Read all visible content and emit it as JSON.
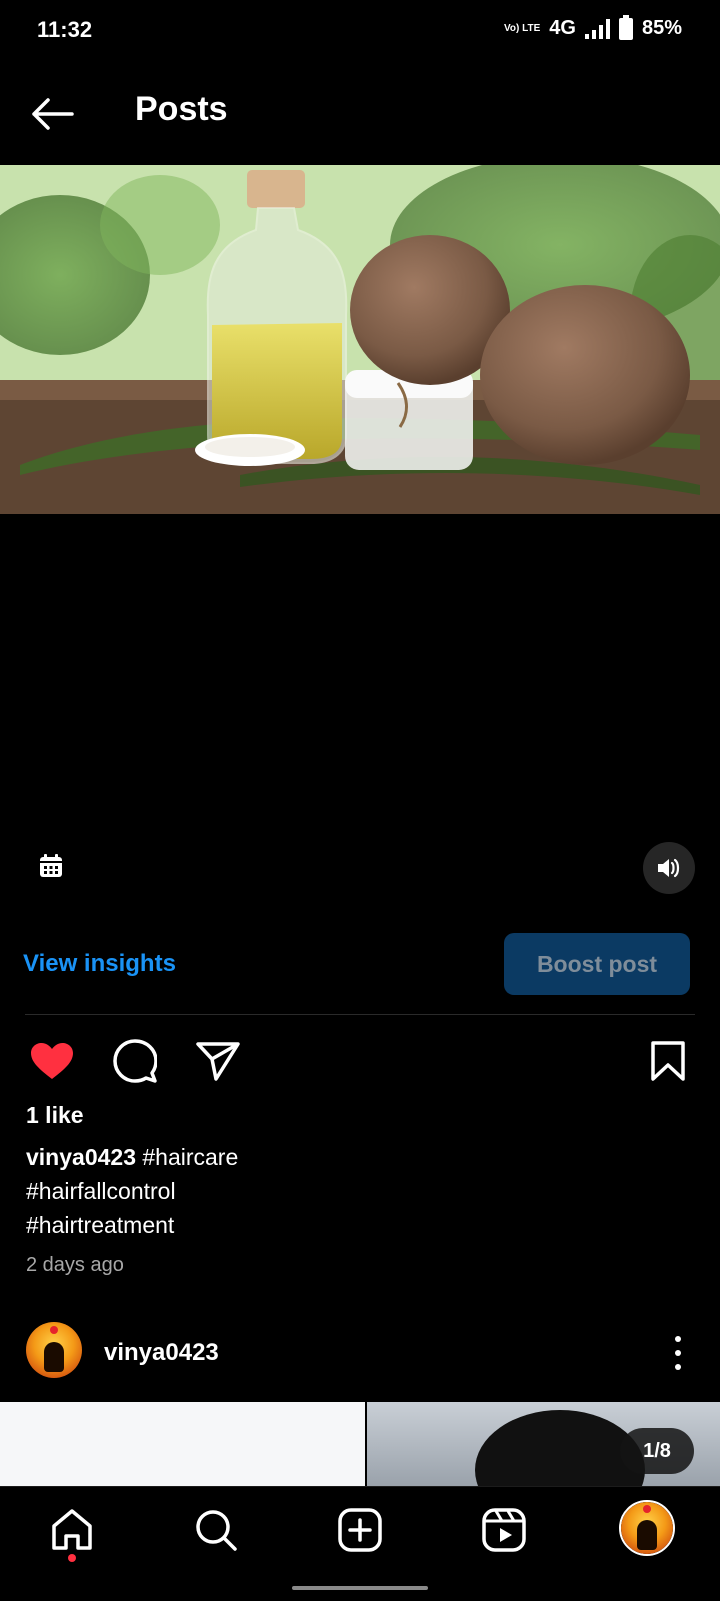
{
  "status_bar": {
    "time": "11:32",
    "volte": "Vo) LTE",
    "network": "4G",
    "battery": "85%"
  },
  "header": {
    "title": "Posts"
  },
  "post": {
    "view_insights_label": "View insights",
    "boost_label": "Boost post",
    "likes": "1 like",
    "caption_user": "vinya0423",
    "caption_line1": "#haircare",
    "caption_line2": "#hairfallcontrol",
    "caption_line3": "#hairtreatment",
    "time_ago": "2 days ago"
  },
  "next_post": {
    "username": "vinya0423",
    "counter": "1/8"
  },
  "icons": {
    "back": "arrow-left-icon",
    "calendar": "calendar-icon",
    "volume": "volume-icon",
    "like": "heart-icon",
    "comment": "comment-icon",
    "share": "send-icon",
    "save": "bookmark-icon",
    "more": "more-vertical-icon",
    "nav_home": "home-icon",
    "nav_search": "search-icon",
    "nav_create": "add-icon",
    "nav_reels": "reels-icon"
  },
  "colors": {
    "link": "#1a93f6",
    "boost_bg": "#0b3a63",
    "like": "#ff3040"
  }
}
